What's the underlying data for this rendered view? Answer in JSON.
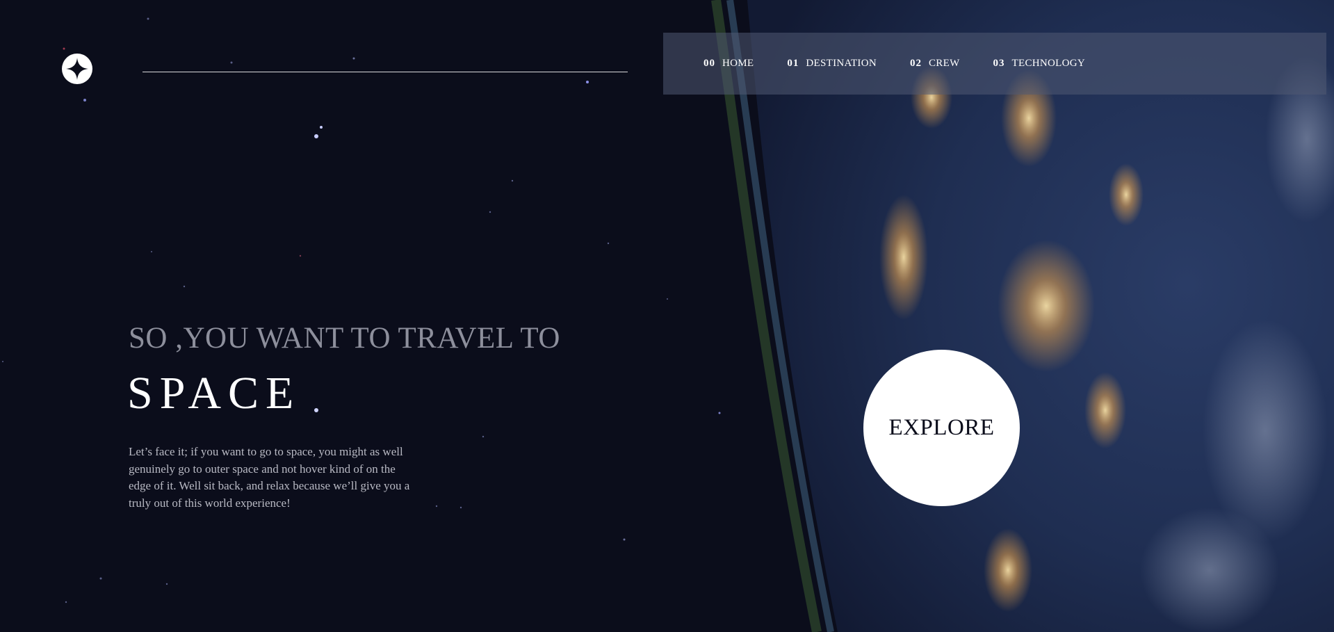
{
  "logo": {
    "icon": "star-icon"
  },
  "nav": {
    "items": [
      {
        "number": "00",
        "label": "HOME"
      },
      {
        "number": "01",
        "label": "DESTINATION"
      },
      {
        "number": "02",
        "label": "CREW"
      },
      {
        "number": "03",
        "label": "TECHNOLOGY"
      }
    ]
  },
  "hero": {
    "subtitle": "SO ,YOU WANT TO TRAVEL TO",
    "title": "SPACE",
    "description": "Let’s face it; if you want to go to space, you might as well genuinely go to outer space and not hover kind of on the edge of it. Well sit back, and relax because we’ll give you a truly out of this world experience!",
    "cta_label": "EXPLORE"
  },
  "colors": {
    "background": "#0b0d1b",
    "nav_background": "#505a73",
    "subtitle": "#8d8f9c",
    "text": "#ffffff",
    "cta_background": "#ffffff",
    "cta_text": "#0b0d1b"
  }
}
